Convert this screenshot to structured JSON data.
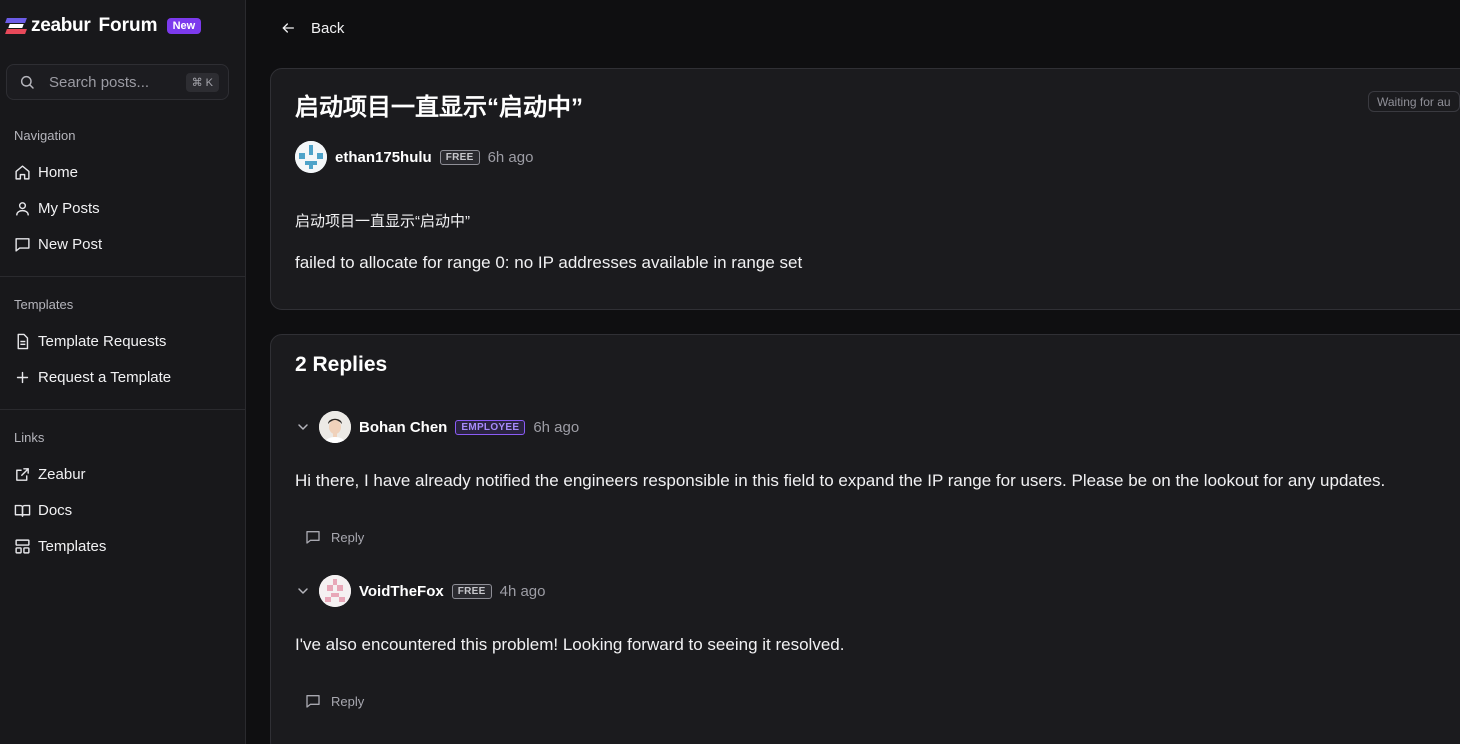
{
  "brand": {
    "name": "zeabur",
    "product": "Forum",
    "badge": "New"
  },
  "search": {
    "placeholder": "Search posts...",
    "shortcut": "⌘ K"
  },
  "sidebar": {
    "navigation": {
      "title": "Navigation",
      "items": [
        {
          "label": "Home",
          "icon": "home-icon"
        },
        {
          "label": "My Posts",
          "icon": "user-icon"
        },
        {
          "label": "New Post",
          "icon": "message-square-icon"
        }
      ]
    },
    "templates": {
      "title": "Templates",
      "items": [
        {
          "label": "Template Requests",
          "icon": "file-text-icon"
        },
        {
          "label": "Request a Template",
          "icon": "plus-icon"
        }
      ]
    },
    "links": {
      "title": "Links",
      "items": [
        {
          "label": "Zeabur",
          "icon": "external-link-icon"
        },
        {
          "label": "Docs",
          "icon": "book-open-icon"
        },
        {
          "label": "Templates",
          "icon": "layout-icon"
        }
      ]
    }
  },
  "back_label": "Back",
  "post": {
    "title": "启动项目一直显示“启动中”",
    "status": "Waiting for au",
    "author": {
      "name": "ethan175hulu",
      "tier": "FREE",
      "time": "6h ago"
    },
    "body": [
      "启动项目一直显示“启动中”",
      "failed to allocate for range 0: no IP addresses available in range set"
    ]
  },
  "replies": {
    "title": "2 Replies",
    "items": [
      {
        "author": "Bohan Chen",
        "tier": "EMPLOYEE",
        "time": "6h ago",
        "text": "Hi there, I have already notified the engineers responsible in this field to expand the IP range for users. Please be on the lookout for any updates.",
        "reply_label": "Reply"
      },
      {
        "author": "VoidTheFox",
        "tier": "FREE",
        "time": "4h ago",
        "text": "I've also encountered this problem! Looking forward to seeing it resolved.",
        "reply_label": "Reply"
      }
    ]
  },
  "colors": {
    "accent": "#7c3aed",
    "employee": "#a78bfa",
    "background": "#0f0f11",
    "card": "#1b1b1e"
  }
}
